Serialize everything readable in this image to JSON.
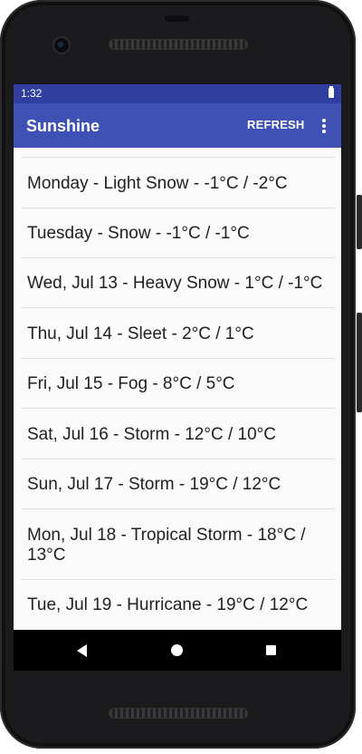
{
  "status_bar": {
    "time": "1:32"
  },
  "app_bar": {
    "title": "Sunshine",
    "refresh_label": "REFRESH"
  },
  "forecast": [
    "Monday - Light Snow - -1°C / -2°C",
    "Tuesday - Snow - -1°C / -1°C",
    "Wed, Jul 13 - Heavy Snow - 1°C / -1°C",
    "Thu, Jul 14 - Sleet - 2°C / 1°C",
    "Fri, Jul 15 - Fog - 8°C / 5°C",
    "Sat, Jul 16 - Storm - 12°C / 10°C",
    "Sun, Jul 17 - Storm - 19°C / 12°C",
    "Mon, Jul 18 - Tropical Storm - 18°C / 13°C",
    "Tue, Jul 19 - Hurricane - 19°C / 12°C"
  ],
  "colors": {
    "primary": "#3f51b5",
    "primary_dark": "#303f9f"
  },
  "icons": [
    "battery-icon",
    "overflow-menu-icon",
    "nav-back-icon",
    "nav-home-icon",
    "nav-recents-icon"
  ]
}
